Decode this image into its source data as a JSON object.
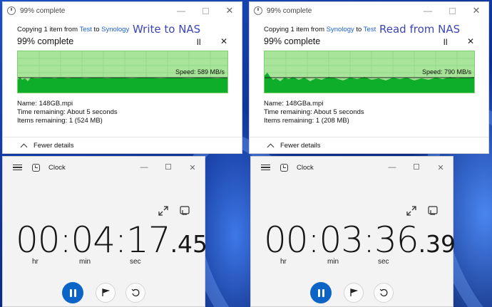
{
  "copy_dialogs": [
    {
      "title": "99% complete",
      "copy_prefix": "Copying 1 item from ",
      "source": "Test",
      "mid": " to ",
      "dest": "Synology",
      "annotation": "Write to NAS",
      "percent": "99% complete",
      "progress_fraction": 0.99,
      "speed": "Speed: 589 MB/s",
      "name_line": "Name:  148GB.mpi",
      "time_line": "Time remaining:  About 5 seconds",
      "items_line": "Items remaining:  1 (524 MB)",
      "fewer_details": "Fewer details"
    },
    {
      "title": "99% complete",
      "copy_prefix": "Copying 1 item from ",
      "source": "Synology",
      "mid": " to ",
      "dest": "Test",
      "annotation": "Read from NAS",
      "percent": "99% complete",
      "progress_fraction": 0.99,
      "speed": "Speed: 790 MB/s",
      "name_line": "Name:  148GBa.mpi",
      "time_line": "Time remaining:  About 5 seconds",
      "items_line": "Items remaining:  1 (208 MB)",
      "fewer_details": "Fewer details"
    }
  ],
  "clocks": [
    {
      "title": "Clock",
      "time_main": "00:04:17",
      "time_frac": ".45",
      "units": [
        "hr",
        "min",
        "sec"
      ]
    },
    {
      "title": "Clock",
      "time_main": "00:03:36",
      "time_frac": ".39",
      "units": [
        "hr",
        "min",
        "sec"
      ]
    }
  ],
  "colors": {
    "graph_bg": "#a8e59a",
    "graph_fill": "#0fae2a",
    "link": "#1a5fd0",
    "annotation": "#3b45b8",
    "accent": "#0d64c7"
  },
  "icons": {
    "copy_title": "progress-ring-icon",
    "clock_title": "clock-app-icon",
    "expand": "expand-icon",
    "compact": "compact-overlay-icon",
    "flag": "flag-icon",
    "reset": "reset-icon"
  }
}
